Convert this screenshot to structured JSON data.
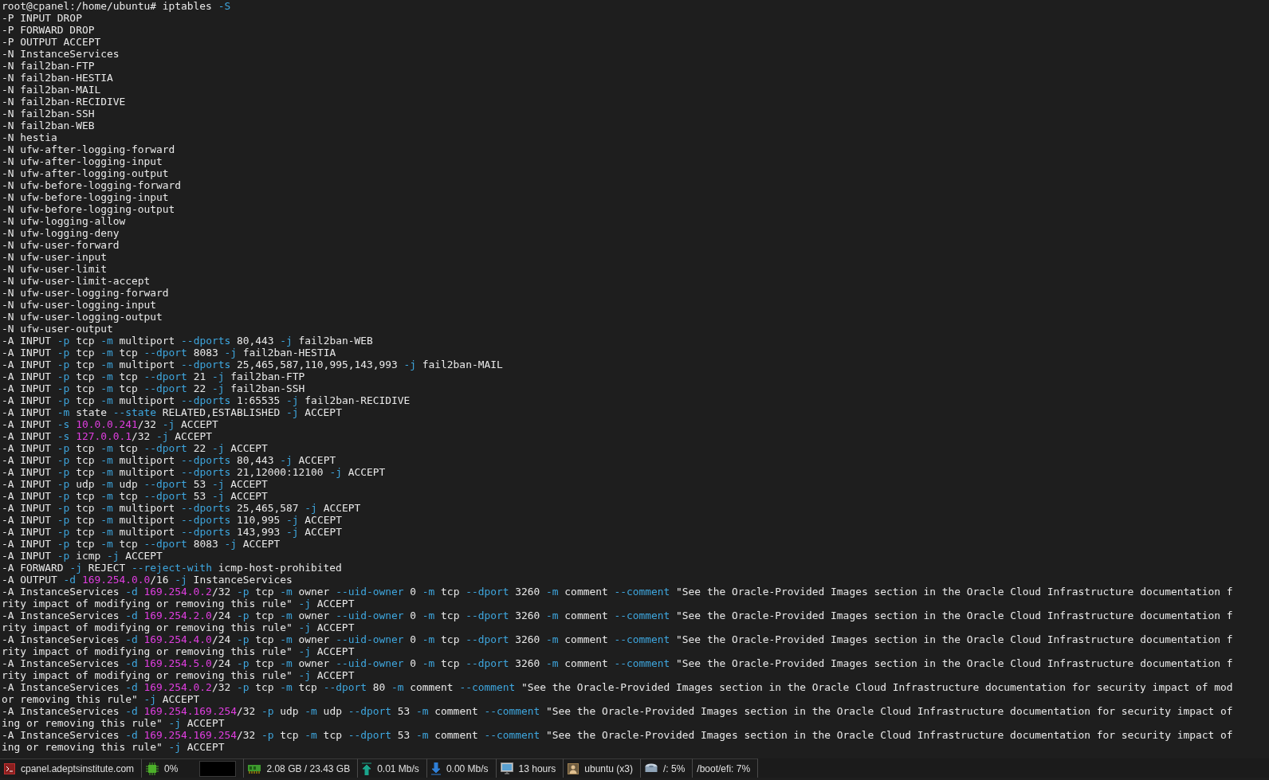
{
  "terminal": {
    "lines": [
      {
        "segments": [
          {
            "kind": "plain",
            "text": "root@cpanel:/home/ubuntu# iptables "
          },
          {
            "kind": "flag",
            "text": "-S"
          }
        ]
      },
      {
        "segments": [
          {
            "kind": "plain",
            "text": "-P INPUT DROP"
          }
        ]
      },
      {
        "segments": [
          {
            "kind": "plain",
            "text": "-P FORWARD DROP"
          }
        ]
      },
      {
        "segments": [
          {
            "kind": "plain",
            "text": "-P OUTPUT ACCEPT"
          }
        ]
      },
      {
        "segments": [
          {
            "kind": "plain",
            "text": "-N InstanceServices"
          }
        ]
      },
      {
        "segments": [
          {
            "kind": "plain",
            "text": "-N fail2ban-FTP"
          }
        ]
      },
      {
        "segments": [
          {
            "kind": "plain",
            "text": "-N fail2ban-HESTIA"
          }
        ]
      },
      {
        "segments": [
          {
            "kind": "plain",
            "text": "-N fail2ban-MAIL"
          }
        ]
      },
      {
        "segments": [
          {
            "kind": "plain",
            "text": "-N fail2ban-RECIDIVE"
          }
        ]
      },
      {
        "segments": [
          {
            "kind": "plain",
            "text": "-N fail2ban-SSH"
          }
        ]
      },
      {
        "segments": [
          {
            "kind": "plain",
            "text": "-N fail2ban-WEB"
          }
        ]
      },
      {
        "segments": [
          {
            "kind": "plain",
            "text": "-N hestia"
          }
        ]
      },
      {
        "segments": [
          {
            "kind": "plain",
            "text": "-N ufw-after-logging-forward"
          }
        ]
      },
      {
        "segments": [
          {
            "kind": "plain",
            "text": "-N ufw-after-logging-input"
          }
        ]
      },
      {
        "segments": [
          {
            "kind": "plain",
            "text": "-N ufw-after-logging-output"
          }
        ]
      },
      {
        "segments": [
          {
            "kind": "plain",
            "text": "-N ufw-before-logging-forward"
          }
        ]
      },
      {
        "segments": [
          {
            "kind": "plain",
            "text": "-N ufw-before-logging-input"
          }
        ]
      },
      {
        "segments": [
          {
            "kind": "plain",
            "text": "-N ufw-before-logging-output"
          }
        ]
      },
      {
        "segments": [
          {
            "kind": "plain",
            "text": "-N ufw-logging-allow"
          }
        ]
      },
      {
        "segments": [
          {
            "kind": "plain",
            "text": "-N ufw-logging-deny"
          }
        ]
      },
      {
        "segments": [
          {
            "kind": "plain",
            "text": "-N ufw-user-forward"
          }
        ]
      },
      {
        "segments": [
          {
            "kind": "plain",
            "text": "-N ufw-user-input"
          }
        ]
      },
      {
        "segments": [
          {
            "kind": "plain",
            "text": "-N ufw-user-limit"
          }
        ]
      },
      {
        "segments": [
          {
            "kind": "plain",
            "text": "-N ufw-user-limit-accept"
          }
        ]
      },
      {
        "segments": [
          {
            "kind": "plain",
            "text": "-N ufw-user-logging-forward"
          }
        ]
      },
      {
        "segments": [
          {
            "kind": "plain",
            "text": "-N ufw-user-logging-input"
          }
        ]
      },
      {
        "segments": [
          {
            "kind": "plain",
            "text": "-N ufw-user-logging-output"
          }
        ]
      },
      {
        "segments": [
          {
            "kind": "plain",
            "text": "-N ufw-user-output"
          }
        ]
      },
      {
        "segments": [
          {
            "kind": "plain",
            "text": "-A INPUT "
          },
          {
            "kind": "flag",
            "text": "-p"
          },
          {
            "kind": "plain",
            "text": " tcp "
          },
          {
            "kind": "flag",
            "text": "-m"
          },
          {
            "kind": "plain",
            "text": " multiport "
          },
          {
            "kind": "flag",
            "text": "--dports"
          },
          {
            "kind": "plain",
            "text": " 80,443 "
          },
          {
            "kind": "flag",
            "text": "-j"
          },
          {
            "kind": "plain",
            "text": " fail2ban-WEB"
          }
        ]
      },
      {
        "segments": [
          {
            "kind": "plain",
            "text": "-A INPUT "
          },
          {
            "kind": "flag",
            "text": "-p"
          },
          {
            "kind": "plain",
            "text": " tcp "
          },
          {
            "kind": "flag",
            "text": "-m"
          },
          {
            "kind": "plain",
            "text": " tcp "
          },
          {
            "kind": "flag",
            "text": "--dport"
          },
          {
            "kind": "plain",
            "text": " 8083 "
          },
          {
            "kind": "flag",
            "text": "-j"
          },
          {
            "kind": "plain",
            "text": " fail2ban-HESTIA"
          }
        ]
      },
      {
        "segments": [
          {
            "kind": "plain",
            "text": "-A INPUT "
          },
          {
            "kind": "flag",
            "text": "-p"
          },
          {
            "kind": "plain",
            "text": " tcp "
          },
          {
            "kind": "flag",
            "text": "-m"
          },
          {
            "kind": "plain",
            "text": " multiport "
          },
          {
            "kind": "flag",
            "text": "--dports"
          },
          {
            "kind": "plain",
            "text": " 25,465,587,110,995,143,993 "
          },
          {
            "kind": "flag",
            "text": "-j"
          },
          {
            "kind": "plain",
            "text": " fail2ban-MAIL"
          }
        ]
      },
      {
        "segments": [
          {
            "kind": "plain",
            "text": "-A INPUT "
          },
          {
            "kind": "flag",
            "text": "-p"
          },
          {
            "kind": "plain",
            "text": " tcp "
          },
          {
            "kind": "flag",
            "text": "-m"
          },
          {
            "kind": "plain",
            "text": " tcp "
          },
          {
            "kind": "flag",
            "text": "--dport"
          },
          {
            "kind": "plain",
            "text": " 21 "
          },
          {
            "kind": "flag",
            "text": "-j"
          },
          {
            "kind": "plain",
            "text": " fail2ban-FTP"
          }
        ]
      },
      {
        "segments": [
          {
            "kind": "plain",
            "text": "-A INPUT "
          },
          {
            "kind": "flag",
            "text": "-p"
          },
          {
            "kind": "plain",
            "text": " tcp "
          },
          {
            "kind": "flag",
            "text": "-m"
          },
          {
            "kind": "plain",
            "text": " tcp "
          },
          {
            "kind": "flag",
            "text": "--dport"
          },
          {
            "kind": "plain",
            "text": " 22 "
          },
          {
            "kind": "flag",
            "text": "-j"
          },
          {
            "kind": "plain",
            "text": " fail2ban-SSH"
          }
        ]
      },
      {
        "segments": [
          {
            "kind": "plain",
            "text": "-A INPUT "
          },
          {
            "kind": "flag",
            "text": "-p"
          },
          {
            "kind": "plain",
            "text": " tcp "
          },
          {
            "kind": "flag",
            "text": "-m"
          },
          {
            "kind": "plain",
            "text": " multiport "
          },
          {
            "kind": "flag",
            "text": "--dports"
          },
          {
            "kind": "plain",
            "text": " 1:65535 "
          },
          {
            "kind": "flag",
            "text": "-j"
          },
          {
            "kind": "plain",
            "text": " fail2ban-RECIDIVE"
          }
        ]
      },
      {
        "segments": [
          {
            "kind": "plain",
            "text": "-A INPUT "
          },
          {
            "kind": "flag",
            "text": "-m"
          },
          {
            "kind": "plain",
            "text": " state "
          },
          {
            "kind": "flag",
            "text": "--state"
          },
          {
            "kind": "plain",
            "text": " RELATED,ESTABLISHED "
          },
          {
            "kind": "flag",
            "text": "-j"
          },
          {
            "kind": "plain",
            "text": " ACCEPT"
          }
        ]
      },
      {
        "segments": [
          {
            "kind": "plain",
            "text": "-A INPUT "
          },
          {
            "kind": "flag",
            "text": "-s "
          },
          {
            "kind": "address",
            "text": "10.0.0.241"
          },
          {
            "kind": "plain",
            "text": "/32 "
          },
          {
            "kind": "flag",
            "text": "-j"
          },
          {
            "kind": "plain",
            "text": " ACCEPT"
          }
        ]
      },
      {
        "segments": [
          {
            "kind": "plain",
            "text": "-A INPUT "
          },
          {
            "kind": "flag",
            "text": "-s "
          },
          {
            "kind": "address",
            "text": "127.0.0.1"
          },
          {
            "kind": "plain",
            "text": "/32 "
          },
          {
            "kind": "flag",
            "text": "-j"
          },
          {
            "kind": "plain",
            "text": " ACCEPT"
          }
        ]
      },
      {
        "segments": [
          {
            "kind": "plain",
            "text": "-A INPUT "
          },
          {
            "kind": "flag",
            "text": "-p"
          },
          {
            "kind": "plain",
            "text": " tcp "
          },
          {
            "kind": "flag",
            "text": "-m"
          },
          {
            "kind": "plain",
            "text": " tcp "
          },
          {
            "kind": "flag",
            "text": "--dport"
          },
          {
            "kind": "plain",
            "text": " 22 "
          },
          {
            "kind": "flag",
            "text": "-j"
          },
          {
            "kind": "plain",
            "text": " ACCEPT"
          }
        ]
      },
      {
        "segments": [
          {
            "kind": "plain",
            "text": "-A INPUT "
          },
          {
            "kind": "flag",
            "text": "-p"
          },
          {
            "kind": "plain",
            "text": " tcp "
          },
          {
            "kind": "flag",
            "text": "-m"
          },
          {
            "kind": "plain",
            "text": " multiport "
          },
          {
            "kind": "flag",
            "text": "--dports"
          },
          {
            "kind": "plain",
            "text": " 80,443 "
          },
          {
            "kind": "flag",
            "text": "-j"
          },
          {
            "kind": "plain",
            "text": " ACCEPT"
          }
        ]
      },
      {
        "segments": [
          {
            "kind": "plain",
            "text": "-A INPUT "
          },
          {
            "kind": "flag",
            "text": "-p"
          },
          {
            "kind": "plain",
            "text": " tcp "
          },
          {
            "kind": "flag",
            "text": "-m"
          },
          {
            "kind": "plain",
            "text": " multiport "
          },
          {
            "kind": "flag",
            "text": "--dports"
          },
          {
            "kind": "plain",
            "text": " 21,12000:12100 "
          },
          {
            "kind": "flag",
            "text": "-j"
          },
          {
            "kind": "plain",
            "text": " ACCEPT"
          }
        ]
      },
      {
        "segments": [
          {
            "kind": "plain",
            "text": "-A INPUT "
          },
          {
            "kind": "flag",
            "text": "-p"
          },
          {
            "kind": "plain",
            "text": " udp "
          },
          {
            "kind": "flag",
            "text": "-m"
          },
          {
            "kind": "plain",
            "text": " udp "
          },
          {
            "kind": "flag",
            "text": "--dport"
          },
          {
            "kind": "plain",
            "text": " 53 "
          },
          {
            "kind": "flag",
            "text": "-j"
          },
          {
            "kind": "plain",
            "text": " ACCEPT"
          }
        ]
      },
      {
        "segments": [
          {
            "kind": "plain",
            "text": "-A INPUT "
          },
          {
            "kind": "flag",
            "text": "-p"
          },
          {
            "kind": "plain",
            "text": " tcp "
          },
          {
            "kind": "flag",
            "text": "-m"
          },
          {
            "kind": "plain",
            "text": " tcp "
          },
          {
            "kind": "flag",
            "text": "--dport"
          },
          {
            "kind": "plain",
            "text": " 53 "
          },
          {
            "kind": "flag",
            "text": "-j"
          },
          {
            "kind": "plain",
            "text": " ACCEPT"
          }
        ]
      },
      {
        "segments": [
          {
            "kind": "plain",
            "text": "-A INPUT "
          },
          {
            "kind": "flag",
            "text": "-p"
          },
          {
            "kind": "plain",
            "text": " tcp "
          },
          {
            "kind": "flag",
            "text": "-m"
          },
          {
            "kind": "plain",
            "text": " multiport "
          },
          {
            "kind": "flag",
            "text": "--dports"
          },
          {
            "kind": "plain",
            "text": " 25,465,587 "
          },
          {
            "kind": "flag",
            "text": "-j"
          },
          {
            "kind": "plain",
            "text": " ACCEPT"
          }
        ]
      },
      {
        "segments": [
          {
            "kind": "plain",
            "text": "-A INPUT "
          },
          {
            "kind": "flag",
            "text": "-p"
          },
          {
            "kind": "plain",
            "text": " tcp "
          },
          {
            "kind": "flag",
            "text": "-m"
          },
          {
            "kind": "plain",
            "text": " multiport "
          },
          {
            "kind": "flag",
            "text": "--dports"
          },
          {
            "kind": "plain",
            "text": " 110,995 "
          },
          {
            "kind": "flag",
            "text": "-j"
          },
          {
            "kind": "plain",
            "text": " ACCEPT"
          }
        ]
      },
      {
        "segments": [
          {
            "kind": "plain",
            "text": "-A INPUT "
          },
          {
            "kind": "flag",
            "text": "-p"
          },
          {
            "kind": "plain",
            "text": " tcp "
          },
          {
            "kind": "flag",
            "text": "-m"
          },
          {
            "kind": "plain",
            "text": " multiport "
          },
          {
            "kind": "flag",
            "text": "--dports"
          },
          {
            "kind": "plain",
            "text": " 143,993 "
          },
          {
            "kind": "flag",
            "text": "-j"
          },
          {
            "kind": "plain",
            "text": " ACCEPT"
          }
        ]
      },
      {
        "segments": [
          {
            "kind": "plain",
            "text": "-A INPUT "
          },
          {
            "kind": "flag",
            "text": "-p"
          },
          {
            "kind": "plain",
            "text": " tcp "
          },
          {
            "kind": "flag",
            "text": "-m"
          },
          {
            "kind": "plain",
            "text": " tcp "
          },
          {
            "kind": "flag",
            "text": "--dport"
          },
          {
            "kind": "plain",
            "text": " 8083 "
          },
          {
            "kind": "flag",
            "text": "-j"
          },
          {
            "kind": "plain",
            "text": " ACCEPT"
          }
        ]
      },
      {
        "segments": [
          {
            "kind": "plain",
            "text": "-A INPUT "
          },
          {
            "kind": "flag",
            "text": "-p"
          },
          {
            "kind": "plain",
            "text": " icmp "
          },
          {
            "kind": "flag",
            "text": "-j"
          },
          {
            "kind": "plain",
            "text": " ACCEPT"
          }
        ]
      },
      {
        "segments": [
          {
            "kind": "plain",
            "text": "-A FORWARD "
          },
          {
            "kind": "flag",
            "text": "-j"
          },
          {
            "kind": "plain",
            "text": " REJECT "
          },
          {
            "kind": "flag",
            "text": "--reject-with"
          },
          {
            "kind": "plain",
            "text": " icmp-host-prohibited"
          }
        ]
      },
      {
        "segments": [
          {
            "kind": "plain",
            "text": "-A OUTPUT "
          },
          {
            "kind": "flag",
            "text": "-d "
          },
          {
            "kind": "address",
            "text": "169.254.0.0"
          },
          {
            "kind": "plain",
            "text": "/16 "
          },
          {
            "kind": "flag",
            "text": "-j"
          },
          {
            "kind": "plain",
            "text": " InstanceServices"
          }
        ]
      },
      {
        "segments": [
          {
            "kind": "plain",
            "text": "-A InstanceServices "
          },
          {
            "kind": "flag",
            "text": "-d "
          },
          {
            "kind": "address",
            "text": "169.254.0.2"
          },
          {
            "kind": "plain",
            "text": "/32 "
          },
          {
            "kind": "flag",
            "text": "-p"
          },
          {
            "kind": "plain",
            "text": " tcp "
          },
          {
            "kind": "flag",
            "text": "-m"
          },
          {
            "kind": "plain",
            "text": " owner "
          },
          {
            "kind": "flag",
            "text": "--uid-owner"
          },
          {
            "kind": "plain",
            "text": " 0 "
          },
          {
            "kind": "flag",
            "text": "-m"
          },
          {
            "kind": "plain",
            "text": " tcp "
          },
          {
            "kind": "flag",
            "text": "--dport"
          },
          {
            "kind": "plain",
            "text": " 3260 "
          },
          {
            "kind": "flag",
            "text": "-m"
          },
          {
            "kind": "plain",
            "text": " comment "
          },
          {
            "kind": "flag",
            "text": "--comment"
          },
          {
            "kind": "plain",
            "text": " \"See the Oracle-Provided Images section in the Oracle Cloud Infrastructure documentation f"
          }
        ]
      },
      {
        "segments": [
          {
            "kind": "plain",
            "text": "rity impact of modifying or removing this rule\" "
          },
          {
            "kind": "flag",
            "text": "-j"
          },
          {
            "kind": "plain",
            "text": " ACCEPT"
          }
        ]
      },
      {
        "segments": [
          {
            "kind": "plain",
            "text": "-A InstanceServices "
          },
          {
            "kind": "flag",
            "text": "-d "
          },
          {
            "kind": "address",
            "text": "169.254.2.0"
          },
          {
            "kind": "plain",
            "text": "/24 "
          },
          {
            "kind": "flag",
            "text": "-p"
          },
          {
            "kind": "plain",
            "text": " tcp "
          },
          {
            "kind": "flag",
            "text": "-m"
          },
          {
            "kind": "plain",
            "text": " owner "
          },
          {
            "kind": "flag",
            "text": "--uid-owner"
          },
          {
            "kind": "plain",
            "text": " 0 "
          },
          {
            "kind": "flag",
            "text": "-m"
          },
          {
            "kind": "plain",
            "text": " tcp "
          },
          {
            "kind": "flag",
            "text": "--dport"
          },
          {
            "kind": "plain",
            "text": " 3260 "
          },
          {
            "kind": "flag",
            "text": "-m"
          },
          {
            "kind": "plain",
            "text": " comment "
          },
          {
            "kind": "flag",
            "text": "--comment"
          },
          {
            "kind": "plain",
            "text": " \"See the Oracle-Provided Images section in the Oracle Cloud Infrastructure documentation f"
          }
        ]
      },
      {
        "segments": [
          {
            "kind": "plain",
            "text": "rity impact of modifying or removing this rule\" "
          },
          {
            "kind": "flag",
            "text": "-j"
          },
          {
            "kind": "plain",
            "text": " ACCEPT"
          }
        ]
      },
      {
        "segments": [
          {
            "kind": "plain",
            "text": "-A InstanceServices "
          },
          {
            "kind": "flag",
            "text": "-d "
          },
          {
            "kind": "address",
            "text": "169.254.4.0"
          },
          {
            "kind": "plain",
            "text": "/24 "
          },
          {
            "kind": "flag",
            "text": "-p"
          },
          {
            "kind": "plain",
            "text": " tcp "
          },
          {
            "kind": "flag",
            "text": "-m"
          },
          {
            "kind": "plain",
            "text": " owner "
          },
          {
            "kind": "flag",
            "text": "--uid-owner"
          },
          {
            "kind": "plain",
            "text": " 0 "
          },
          {
            "kind": "flag",
            "text": "-m"
          },
          {
            "kind": "plain",
            "text": " tcp "
          },
          {
            "kind": "flag",
            "text": "--dport"
          },
          {
            "kind": "plain",
            "text": " 3260 "
          },
          {
            "kind": "flag",
            "text": "-m"
          },
          {
            "kind": "plain",
            "text": " comment "
          },
          {
            "kind": "flag",
            "text": "--comment"
          },
          {
            "kind": "plain",
            "text": " \"See the Oracle-Provided Images section in the Oracle Cloud Infrastructure documentation f"
          }
        ]
      },
      {
        "segments": [
          {
            "kind": "plain",
            "text": "rity impact of modifying or removing this rule\" "
          },
          {
            "kind": "flag",
            "text": "-j"
          },
          {
            "kind": "plain",
            "text": " ACCEPT"
          }
        ]
      },
      {
        "segments": [
          {
            "kind": "plain",
            "text": "-A InstanceServices "
          },
          {
            "kind": "flag",
            "text": "-d "
          },
          {
            "kind": "address",
            "text": "169.254.5.0"
          },
          {
            "kind": "plain",
            "text": "/24 "
          },
          {
            "kind": "flag",
            "text": "-p"
          },
          {
            "kind": "plain",
            "text": " tcp "
          },
          {
            "kind": "flag",
            "text": "-m"
          },
          {
            "kind": "plain",
            "text": " owner "
          },
          {
            "kind": "flag",
            "text": "--uid-owner"
          },
          {
            "kind": "plain",
            "text": " 0 "
          },
          {
            "kind": "flag",
            "text": "-m"
          },
          {
            "kind": "plain",
            "text": " tcp "
          },
          {
            "kind": "flag",
            "text": "--dport"
          },
          {
            "kind": "plain",
            "text": " 3260 "
          },
          {
            "kind": "flag",
            "text": "-m"
          },
          {
            "kind": "plain",
            "text": " comment "
          },
          {
            "kind": "flag",
            "text": "--comment"
          },
          {
            "kind": "plain",
            "text": " \"See the Oracle-Provided Images section in the Oracle Cloud Infrastructure documentation f"
          }
        ]
      },
      {
        "segments": [
          {
            "kind": "plain",
            "text": "rity impact of modifying or removing this rule\" "
          },
          {
            "kind": "flag",
            "text": "-j"
          },
          {
            "kind": "plain",
            "text": " ACCEPT"
          }
        ]
      },
      {
        "segments": [
          {
            "kind": "plain",
            "text": "-A InstanceServices "
          },
          {
            "kind": "flag",
            "text": "-d "
          },
          {
            "kind": "address",
            "text": "169.254.0.2"
          },
          {
            "kind": "plain",
            "text": "/32 "
          },
          {
            "kind": "flag",
            "text": "-p"
          },
          {
            "kind": "plain",
            "text": " tcp "
          },
          {
            "kind": "flag",
            "text": "-m"
          },
          {
            "kind": "plain",
            "text": " tcp "
          },
          {
            "kind": "flag",
            "text": "--dport"
          },
          {
            "kind": "plain",
            "text": " 80 "
          },
          {
            "kind": "flag",
            "text": "-m"
          },
          {
            "kind": "plain",
            "text": " comment "
          },
          {
            "kind": "flag",
            "text": "--comment"
          },
          {
            "kind": "plain",
            "text": " \"See the Oracle-Provided Images section in the Oracle Cloud Infrastructure documentation for security impact of mod"
          }
        ]
      },
      {
        "segments": [
          {
            "kind": "plain",
            "text": "or removing this rule\" "
          },
          {
            "kind": "flag",
            "text": "-j"
          },
          {
            "kind": "plain",
            "text": " ACCEPT"
          }
        ]
      },
      {
        "segments": [
          {
            "kind": "plain",
            "text": "-A InstanceServices "
          },
          {
            "kind": "flag",
            "text": "-d "
          },
          {
            "kind": "address",
            "text": "169.254.169.254"
          },
          {
            "kind": "plain",
            "text": "/32 "
          },
          {
            "kind": "flag",
            "text": "-p"
          },
          {
            "kind": "plain",
            "text": " udp "
          },
          {
            "kind": "flag",
            "text": "-m"
          },
          {
            "kind": "plain",
            "text": " udp "
          },
          {
            "kind": "flag",
            "text": "--dport"
          },
          {
            "kind": "plain",
            "text": " 53 "
          },
          {
            "kind": "flag",
            "text": "-m"
          },
          {
            "kind": "plain",
            "text": " comment "
          },
          {
            "kind": "flag",
            "text": "--comment"
          },
          {
            "kind": "plain",
            "text": " \"See the Oracle-Provided Images section in the Oracle Cloud Infrastructure documentation for security impact of"
          }
        ]
      },
      {
        "segments": [
          {
            "kind": "plain",
            "text": "ing or removing this rule\" "
          },
          {
            "kind": "flag",
            "text": "-j"
          },
          {
            "kind": "plain",
            "text": " ACCEPT"
          }
        ]
      },
      {
        "segments": [
          {
            "kind": "plain",
            "text": "-A InstanceServices "
          },
          {
            "kind": "flag",
            "text": "-d "
          },
          {
            "kind": "address",
            "text": "169.254.169.254"
          },
          {
            "kind": "plain",
            "text": "/32 "
          },
          {
            "kind": "flag",
            "text": "-p"
          },
          {
            "kind": "plain",
            "text": " tcp "
          },
          {
            "kind": "flag",
            "text": "-m"
          },
          {
            "kind": "plain",
            "text": " tcp "
          },
          {
            "kind": "flag",
            "text": "--dport"
          },
          {
            "kind": "plain",
            "text": " 53 "
          },
          {
            "kind": "flag",
            "text": "-m"
          },
          {
            "kind": "plain",
            "text": " comment "
          },
          {
            "kind": "flag",
            "text": "--comment"
          },
          {
            "kind": "plain",
            "text": " \"See the Oracle-Provided Images section in the Oracle Cloud Infrastructure documentation for security impact of"
          }
        ]
      },
      {
        "segments": [
          {
            "kind": "plain",
            "text": "ing or removing this rule\" "
          },
          {
            "kind": "flag",
            "text": "-j"
          },
          {
            "kind": "plain",
            "text": " ACCEPT"
          }
        ]
      }
    ]
  },
  "status_bar": {
    "items": [
      {
        "kind": "host",
        "text": "cpanel.adeptsinstitute.com"
      },
      {
        "kind": "cpu",
        "text": "0%"
      },
      {
        "kind": "memory",
        "text": "2.08 GB / 23.43 GB"
      },
      {
        "kind": "upload",
        "text": "0.01 Mb/s"
      },
      {
        "kind": "download",
        "text": "0.00 Mb/s"
      },
      {
        "kind": "uptime",
        "text": "13 hours"
      },
      {
        "kind": "users",
        "text": "ubuntu (x3)"
      },
      {
        "kind": "disk",
        "text": "/: 5%"
      },
      {
        "kind": "plain",
        "text": "/boot/efi: 7%"
      }
    ]
  }
}
